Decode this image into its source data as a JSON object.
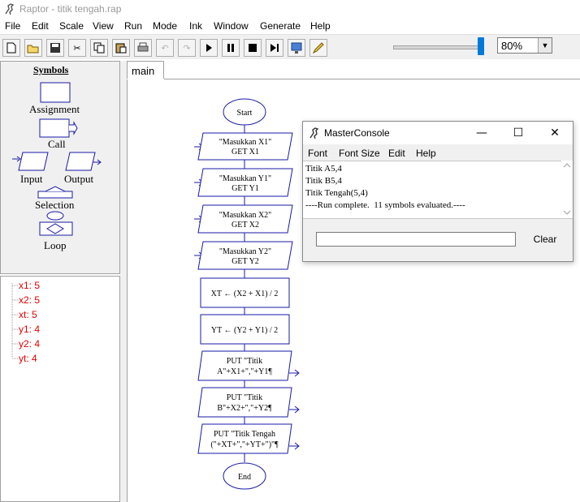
{
  "app": {
    "title": "Raptor - titik tengah.rap"
  },
  "menu": [
    "File",
    "Edit",
    "Scale",
    "View",
    "Run",
    "Mode",
    "Ink",
    "Window",
    "Generate",
    "Help"
  ],
  "toolbar": {
    "buttons": [
      {
        "name": "new-file-icon",
        "glyph": "🗋"
      },
      {
        "name": "open-folder-icon",
        "glyph": "📂"
      },
      {
        "name": "save-icon",
        "glyph": "🖫"
      },
      {
        "name": "cut-icon",
        "glyph": "✂"
      },
      {
        "name": "copy-icon",
        "glyph": "⎘"
      },
      {
        "name": "paste-icon",
        "glyph": "📋"
      },
      {
        "name": "print-icon",
        "glyph": "⎙"
      },
      {
        "name": "undo-icon",
        "glyph": "↶"
      },
      {
        "name": "redo-icon",
        "glyph": "↷"
      },
      {
        "name": "run-icon",
        "glyph": "▶"
      },
      {
        "name": "pause-icon",
        "glyph": "❚❚"
      },
      {
        "name": "stop-icon",
        "glyph": "■"
      },
      {
        "name": "step-icon",
        "glyph": "▶|"
      },
      {
        "name": "test-server-icon",
        "glyph": "🖧"
      },
      {
        "name": "pen-icon",
        "glyph": "✎"
      }
    ],
    "speed_slider": 1.0,
    "zoom": "80%"
  },
  "symbols": {
    "title": "Symbols",
    "items": [
      "Assignment",
      "Call",
      "Input",
      "Output",
      "Selection",
      "Loop"
    ]
  },
  "variables": [
    "x1: 5",
    "x2: 5",
    "xt: 5",
    "y1: 4",
    "y2: 4",
    "yt: 4"
  ],
  "tabs": [
    "main"
  ],
  "flowchart": {
    "start": "Start",
    "end": "End",
    "inputs": [
      {
        "line1": "\"Masukkan X1\"",
        "line2": "GET X1"
      },
      {
        "line1": "\"Masukkan Y1\"",
        "line2": "GET Y1"
      },
      {
        "line1": "\"Masukkan X2\"",
        "line2": "GET X2"
      },
      {
        "line1": "\"Masukkan Y2\"",
        "line2": "GET Y2"
      }
    ],
    "assignments": [
      "XT ← (X2 + X1) / 2",
      "YT ← (Y2 + Y1) / 2"
    ],
    "outputs": [
      {
        "line1": "PUT \"Titik",
        "line2": "A\"+X1+\",\"+Y1¶"
      },
      {
        "line1": "PUT \"Titik",
        "line2": "B\"+X2+\",\"+Y2¶"
      },
      {
        "line1": "PUT \"Titik Tengah",
        "line2": "(\"+XT+\",\"+YT+\")\"¶"
      }
    ]
  },
  "console": {
    "title": "MasterConsole",
    "menu": [
      "Font",
      "Font Size",
      "Edit",
      "Help"
    ],
    "output": [
      "Titik A5,4",
      "Titik B5,4",
      "Titik Tengah(5,4)",
      "----Run complete.  11 symbols evaluated.----"
    ],
    "input_value": "",
    "clear_label": "Clear"
  }
}
